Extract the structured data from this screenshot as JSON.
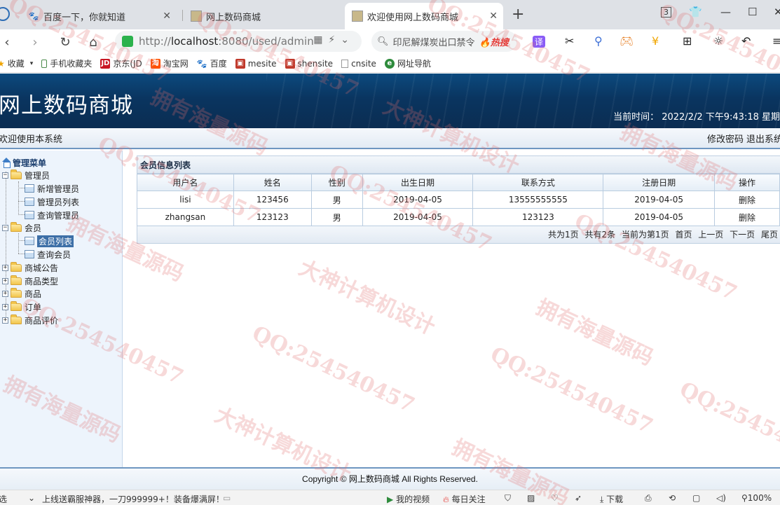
{
  "browser": {
    "tabs": [
      {
        "title": "百度一下，你就知道",
        "active": false
      },
      {
        "title": "网上数码商城",
        "active": false
      },
      {
        "title": "欢迎使用网上数码商城",
        "active": true
      }
    ],
    "tab_count": "3",
    "address": {
      "scheme": "http://",
      "host": "localhost",
      "rest": ":8080/used/admin"
    },
    "search_text": "印尼解煤炭出口禁令",
    "search_hot": "热搜",
    "translate_label": "译",
    "bookmarks": [
      "收藏",
      "手机收藏夹",
      "京东(JD",
      "淘宝网",
      "百度",
      "mesite",
      "shensite",
      "cnsite",
      "网址导航"
    ]
  },
  "header": {
    "title": "网上数码商城",
    "clock_label": "当前时间：",
    "clock_value": "2022/2/2 下午9:43:18 星期",
    "welcome": "欢迎使用本系统",
    "change_password": "修改密码",
    "logout": "退出系统"
  },
  "sidebar": {
    "title": "管理菜单",
    "groups": [
      {
        "label": "管理员",
        "children": [
          "新增管理员",
          "管理员列表",
          "查询管理员"
        ]
      },
      {
        "label": "会员",
        "children": [
          "会员列表",
          "查询会员"
        ]
      },
      {
        "label": "商城公告"
      },
      {
        "label": "商品类型"
      },
      {
        "label": "商品"
      },
      {
        "label": "订单"
      },
      {
        "label": "商品评价"
      }
    ]
  },
  "panel": {
    "title": "会员信息列表",
    "columns": [
      "用户名",
      "姓名",
      "性别",
      "出生日期",
      "联系方式",
      "注册日期",
      "操作"
    ],
    "rows": [
      [
        "lisi",
        "123456",
        "男",
        "2019-04-05",
        "13555555555",
        "2019-04-05",
        "删除"
      ],
      [
        "zhangsan",
        "123123",
        "男",
        "2019-04-05",
        "123123",
        "2019-04-05",
        "删除"
      ]
    ],
    "pager": {
      "total_pages": "共为1页",
      "total_records": "共有2条",
      "current": "当前为第1页",
      "first": "首页",
      "prev": "上一页",
      "next": "下一页",
      "last": "尾页"
    }
  },
  "footer": {
    "copyright": "Copyright © 网上数码商城 All Rights Reserved."
  },
  "statusbar": {
    "left": "选",
    "news": "上线送霸服神器，一刀999999+！装备爆满屏！",
    "my_video": "我的视频",
    "daily": "每日关注",
    "download": "下载",
    "zoom": "100%"
  },
  "watermarks": [
    "QQ:254540457",
    "拥有海量源码",
    "大神计算机设计"
  ]
}
